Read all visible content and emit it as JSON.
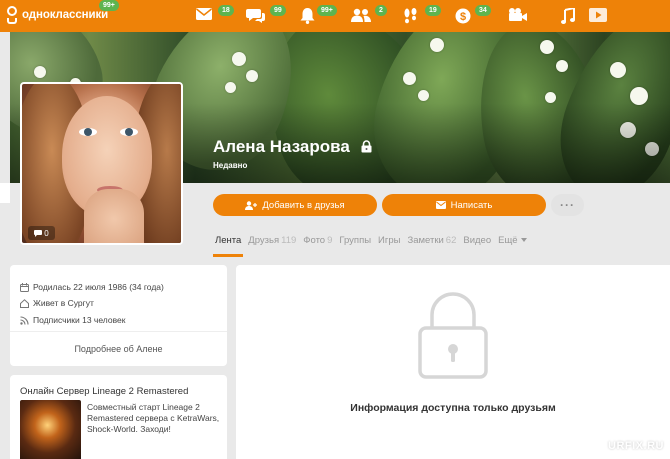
{
  "header": {
    "logo_text": "одноклассники",
    "logo_badge": "99+",
    "nav": [
      {
        "icon": "mail-icon",
        "count": "18"
      },
      {
        "icon": "chat-icon",
        "count": "99"
      },
      {
        "icon": "bell-icon",
        "count": "99+"
      },
      {
        "icon": "friends-icon",
        "count": "2"
      },
      {
        "icon": "footprints-icon",
        "count": "19"
      },
      {
        "icon": "payments-icon",
        "count": "34"
      },
      {
        "icon": "video-camera-icon",
        "count": ""
      },
      {
        "icon": "music-note-icon",
        "count": ""
      },
      {
        "icon": "play-icon",
        "count": ""
      }
    ],
    "accent_color": "#ee8208",
    "badge_color": "#5eb44f"
  },
  "profile": {
    "name": "Алена Назарова",
    "status": "Недавно",
    "photo_comments": "0"
  },
  "actions": {
    "add_friend": "Добавить в друзья",
    "write_message": "Написать",
    "more": "···"
  },
  "tabs": [
    {
      "label": "Лента",
      "count": ""
    },
    {
      "label": "Друзья",
      "count": "119"
    },
    {
      "label": "Фото",
      "count": "9"
    },
    {
      "label": "Группы",
      "count": ""
    },
    {
      "label": "Игры",
      "count": ""
    },
    {
      "label": "Заметки",
      "count": "62"
    },
    {
      "label": "Видео",
      "count": ""
    },
    {
      "label": "Ещё",
      "count": ""
    }
  ],
  "info": {
    "birth": "Родилась 22 июля 1986 (34 года)",
    "location": "Живет в Сургут",
    "subscribers": "Подписчики 13 человек",
    "more_link": "Подробнее об Алене"
  },
  "ad": {
    "title": "Онлайн Сервер Lineage 2 Remastered",
    "text": "Совместный старт Lineage 2 Remastered сервера с KetraWars, Shock-World. Заходи!"
  },
  "locked": {
    "message": "Информация доступна только друзьям"
  },
  "watermark": "URFIX.RU"
}
